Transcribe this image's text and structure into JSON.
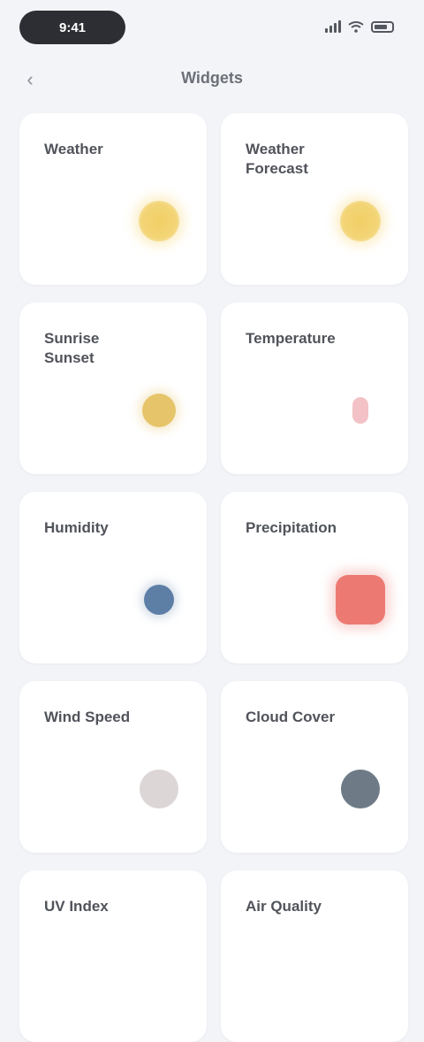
{
  "status_bar": {
    "time": "9:41",
    "icons": [
      "cellular-signal-icon",
      "wifi-icon",
      "battery-icon"
    ]
  },
  "nav": {
    "back_icon": "chevron-left-icon",
    "title": "Widgets"
  },
  "cards": [
    {
      "title": "Weather",
      "icon": "sun-icon"
    },
    {
      "title": "Weather Forecast",
      "icon": "sun-icon"
    },
    {
      "title": "Sunrise Sunset",
      "icon": "sun-icon"
    },
    {
      "title": "Temperature",
      "icon": "thermometer-icon"
    },
    {
      "title": "Humidity",
      "icon": "droplet-icon"
    },
    {
      "title": "Precipitation",
      "icon": "umbrella-icon"
    },
    {
      "title": "Wind Speed",
      "icon": "wind-icon"
    },
    {
      "title": "Cloud Cover",
      "icon": "cloud-icon"
    },
    {
      "title": "UV Index",
      "icon": "uv-icon"
    },
    {
      "title": "Air Quality",
      "icon": "leaf-icon"
    }
  ],
  "colors": {
    "background": "#f2f4f8",
    "card": "#ffffff",
    "sun": "#f1cf65",
    "heart": "#f0b3b8",
    "blue": "#5d7fa6",
    "red": "#ec7a73",
    "gray": "#ddd6d6",
    "slate": "#6e7b86"
  }
}
